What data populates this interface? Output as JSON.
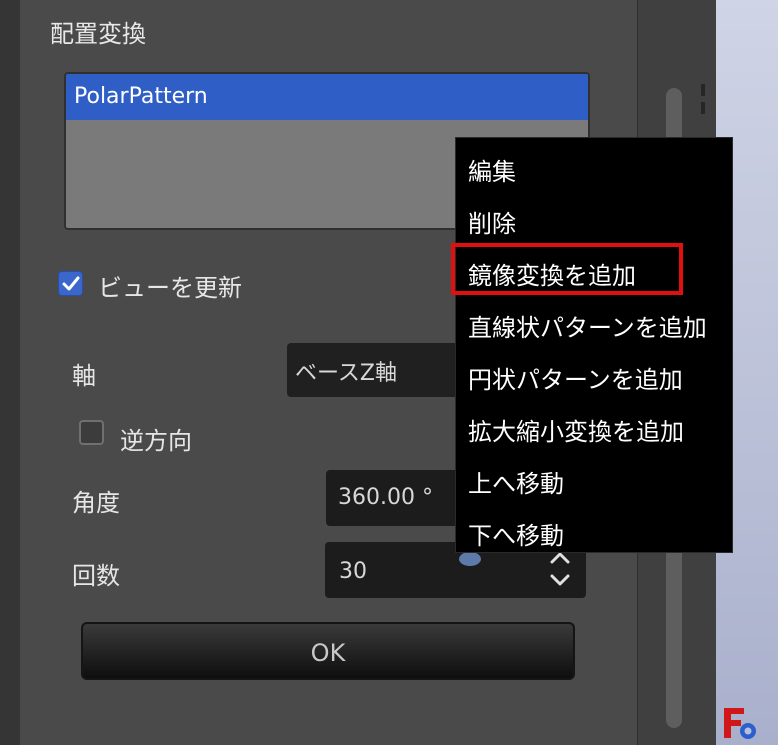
{
  "panel": {
    "title": "配置変換",
    "list_items": [
      "PolarPattern"
    ],
    "update_view": {
      "label": "ビューを更新",
      "checked": true
    },
    "axis": {
      "label": "軸",
      "value": "ベースZ軸"
    },
    "reverse": {
      "label": "逆方向",
      "checked": false
    },
    "angle": {
      "label": "角度",
      "value": "360.00 °"
    },
    "occurrences": {
      "label": "回数",
      "value": "30"
    },
    "ok_label": "OK"
  },
  "context_menu": {
    "items": [
      "編集",
      "削除",
      "鏡像変換を追加",
      "直線状パターンを追加",
      "円状パターンを追加",
      "拡大縮小変換を追加",
      "上へ移動",
      "下へ移動"
    ],
    "highlighted_index": 2
  },
  "colors": {
    "highlight_border": "#e01010",
    "selection": "#2f5fc6"
  },
  "icons": [
    "check-icon",
    "spin-up-icon",
    "spin-down-icon",
    "expression-icon",
    "freecad-logo-icon"
  ]
}
